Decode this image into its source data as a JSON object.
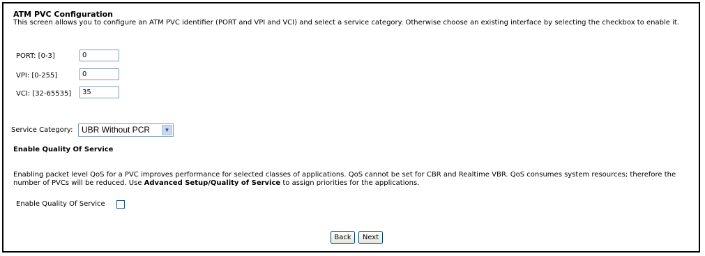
{
  "page": {
    "title": "ATM PVC Configuration",
    "description": "This screen allows you to configure an ATM PVC identifier (PORT and VPI and VCI) and select a service category. Otherwise choose an existing interface by selecting the checkbox to enable it."
  },
  "fields": {
    "port": {
      "label": "PORT: [0-3]",
      "value": "0"
    },
    "vpi": {
      "label": "VPI: [0-255]",
      "value": "0"
    },
    "vci": {
      "label": "VCI: [32-65535]",
      "value": "35"
    }
  },
  "service_category": {
    "label": "Service Category:",
    "selected": "UBR Without PCR"
  },
  "qos": {
    "heading": "Enable Quality Of Service",
    "text_before": "Enabling packet level QoS for a PVC improves performance for selected classes of applications.  QoS cannot be set for CBR and Realtime VBR.  QoS consumes system resources; therefore the number of PVCs will be reduced. Use ",
    "text_link": "Advanced Setup/Quality of Service",
    "text_after": " to assign priorities for the applications.",
    "checkbox_label": "Enable Quality Of Service",
    "checked": false
  },
  "buttons": {
    "back": "Back",
    "next": "Next"
  }
}
